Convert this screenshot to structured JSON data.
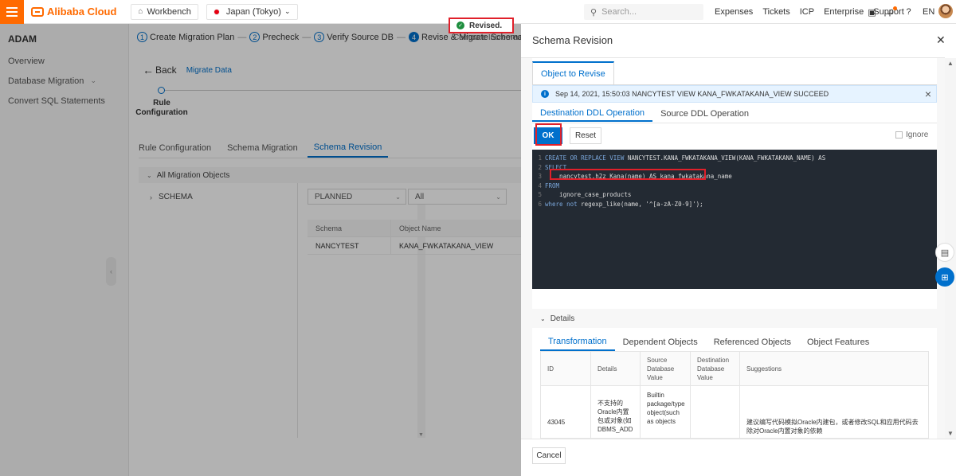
{
  "topbar": {
    "brand": "Alibaba Cloud",
    "workbench": "Workbench",
    "region": "Japan (Tokyo)",
    "search_placeholder": "Search...",
    "links": [
      "Expenses",
      "Tickets",
      "ICP",
      "Enterprise",
      "Support"
    ],
    "language": "EN"
  },
  "sidebar": {
    "title": "ADAM",
    "items": [
      {
        "label": "Overview"
      },
      {
        "label": "Database Migration"
      },
      {
        "label": "Convert SQL Statements"
      }
    ]
  },
  "steps": [
    {
      "num": "1",
      "label": "Create Migration Plan"
    },
    {
      "num": "2",
      "label": "Precheck"
    },
    {
      "num": "3",
      "label": "Verify Source DB"
    },
    {
      "num": "4",
      "label": "Revise & Migrate Schemas"
    },
    {
      "num": "5",
      "label": "Compare Increment"
    }
  ],
  "back": {
    "label": "Back",
    "crumb": "Migrate Data"
  },
  "progress": {
    "label": "Rule Configuration"
  },
  "subtabs": [
    "Rule Configuration",
    "Schema Migration",
    "Schema Revision"
  ],
  "tree": {
    "header": "All Migration Objects",
    "node": "SCHEMA"
  },
  "filters": {
    "status": "PLANNED",
    "type": "All"
  },
  "object_table": {
    "headers": [
      "Schema",
      "Object Name"
    ],
    "rows": [
      [
        "NANCYTEST",
        "KANA_FWKATAKANA_VIEW"
      ]
    ]
  },
  "toast": {
    "message": "Revised."
  },
  "drawer": {
    "title": "Schema Revision",
    "object_tab": "Object to Revise",
    "info": "Sep 14, 2021, 15:50:03 NANCYTEST VIEW KANA_FWKATAKANA_VIEW SUCCEED",
    "ddl_tabs": [
      "Destination DDL Operation",
      "Source DDL Operation"
    ],
    "ok_label": "OK",
    "reset_label": "Reset",
    "ignore_label": "Ignore",
    "code": [
      {
        "n": "1",
        "kw": "CREATE OR REPLACE VIEW",
        "rest": " NANCYTEST.KANA_FWKATAKANA_VIEW(KANA_FWKATAKANA_NAME) AS"
      },
      {
        "n": "2",
        "kw": "SELECT",
        "rest": ""
      },
      {
        "n": "3",
        "kw": "",
        "rest": "    nancytest.h2z_Kana(name) AS kana_fwkatakana_name"
      },
      {
        "n": "4",
        "kw": "FROM",
        "rest": ""
      },
      {
        "n": "5",
        "kw": "",
        "rest": "    ignore_case_products"
      },
      {
        "n": "6",
        "kw": "where not",
        "rest": " regexp_like(name, '^[a-zA-Z0-9]');"
      }
    ],
    "details_label": "Details",
    "detail_tabs": [
      "Transformation",
      "Dependent Objects",
      "Referenced Objects",
      "Object Features"
    ],
    "grid_headers": [
      "ID",
      "Details",
      "Source Database Value",
      "Destination Database Value",
      "Suggestions"
    ],
    "grid_row": {
      "id": "43045",
      "details": "不支持的Oracle内置包或对象(如DBMS_ADD",
      "source": "Builtin package/type object(such as objects",
      "destination": "",
      "suggestion": "建议编写代码模拟Oracle内建包，或者修改SQL和应用代码去除对Oracle内置对象的依赖"
    },
    "cancel_label": "Cancel"
  },
  "colors": {
    "accent": "#0070cc",
    "brand": "#ff6a00",
    "highlight": "#e0202a"
  }
}
